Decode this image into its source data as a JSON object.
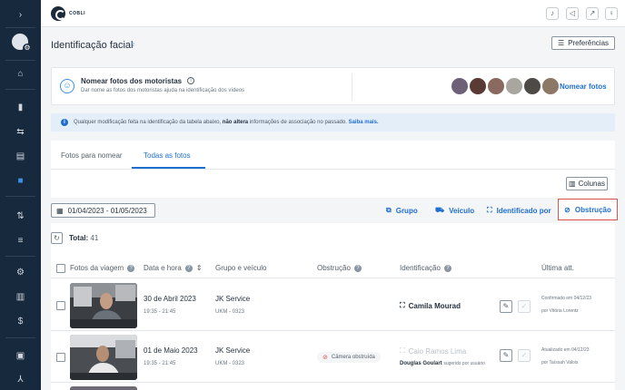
{
  "app": {
    "logo_text": "COBLI"
  },
  "sidebar": {
    "expand_icon": "›",
    "items": [
      {
        "name": "home-icon",
        "glyph": "⌂"
      },
      {
        "name": "map-icon",
        "glyph": "▮"
      },
      {
        "name": "routes-icon",
        "glyph": "⇆"
      },
      {
        "name": "reports-icon",
        "glyph": "▤"
      },
      {
        "name": "video-icon",
        "glyph": "■"
      },
      {
        "name": "graph-icon",
        "glyph": "⇅"
      },
      {
        "name": "tasks-icon",
        "glyph": "≡"
      },
      {
        "name": "settings-icon",
        "glyph": "⚙"
      },
      {
        "name": "chart-icon",
        "glyph": "▥"
      },
      {
        "name": "money-icon",
        "glyph": "$"
      },
      {
        "name": "chat-icon",
        "glyph": "▣"
      },
      {
        "name": "network-icon",
        "glyph": "⅄"
      }
    ]
  },
  "topbar": {
    "icons": [
      "bell-icon",
      "megaphone-icon",
      "external-link-icon",
      "lightbulb-icon"
    ]
  },
  "page": {
    "title": "Identificação facial",
    "preferences_label": "Preferências"
  },
  "name_card": {
    "title": "Nomear fotos dos motoristas",
    "subtitle": "Dar nome as fotos dos motoristas ajuda na identificação dos vídeos",
    "link": "Nomear fotos",
    "face_colors": [
      "#6e6076",
      "#5a3a34",
      "#8a6a5e",
      "#a9a6a0",
      "#4e4a46",
      "#8d7766"
    ]
  },
  "banner": {
    "text_before": "Qualquer modificação feita na identificação da tabela abaixo,",
    "bold": "não altera",
    "text_after": "informações de associação no passado.",
    "link": "Saiba mais."
  },
  "tabs": [
    {
      "label": "Fotos para nomear",
      "active": false
    },
    {
      "label": "Todas as fotos",
      "active": true
    }
  ],
  "toolbar": {
    "columns_label": "Colunas",
    "date_range": "01/04/2023 - 01/05/2023",
    "group_by": [
      "Grupo",
      "Veículo",
      "Identificado por",
      "Obstrução"
    ],
    "selected_group": "Obstrução"
  },
  "total": {
    "label": "Total:",
    "value": "41"
  },
  "table": {
    "headers": [
      "Fotos da viagem",
      "Data e hora",
      "Grupo e veículo",
      "Obstrução",
      "Identificação",
      "Última att."
    ],
    "rows": [
      {
        "date": "30 de Abril 2023",
        "time": "19:35 - 21:45",
        "group": "JK Service",
        "plate": "UKM - 0323",
        "obstruction": "",
        "identification": "Camila Mourad",
        "identification_muted": false,
        "suggested_by": "",
        "suggested_note": "",
        "updated": "Confirmado em 04/12/23",
        "updated_by": "por Vitória Lorentz"
      },
      {
        "date": "01 de Maio 2023",
        "time": "19:35 - 21:45",
        "group": "JK Service",
        "plate": "UKM - 0323",
        "obstruction": "Câmera obstruída",
        "identification": "Caio Ramos Lima",
        "identification_muted": true,
        "suggested_by": "Douglas Goulart",
        "suggested_note": "sugerido por usuário",
        "updated": "Atualizado em 04/12/23",
        "updated_by": "por Taíssah Valois"
      }
    ]
  }
}
